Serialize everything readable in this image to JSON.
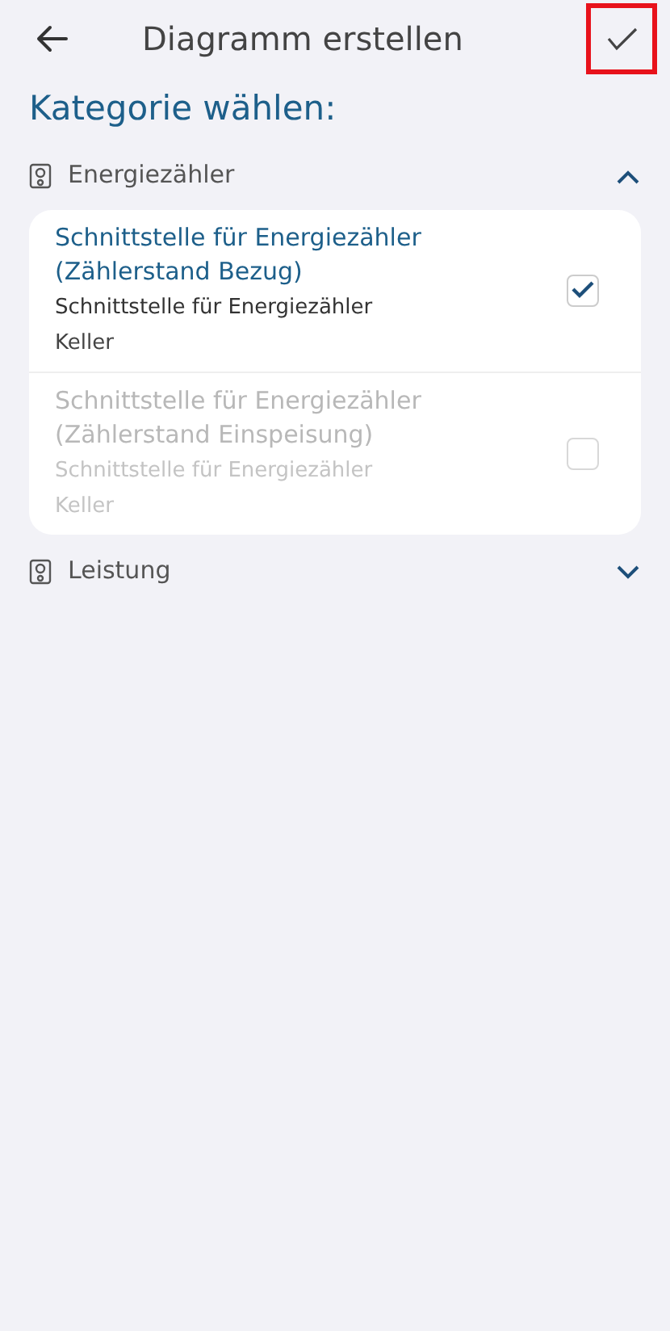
{
  "header": {
    "title": "Diagramm erstellen",
    "confirm_highlighted": true
  },
  "heading": "Kategorie wählen:",
  "groups": [
    {
      "label": "Energiezähler",
      "expanded": true,
      "items": [
        {
          "title": "Schnittstelle für Energiezähler (Zählerstand Bezug)",
          "subtitle": "Schnittstelle für Energiezähler",
          "location": "Keller",
          "checked": true,
          "disabled": false
        },
        {
          "title": "Schnittstelle für Energiezähler (Zählerstand Einspeisung)",
          "subtitle": "Schnittstelle für Energiezähler",
          "location": "Keller",
          "checked": false,
          "disabled": true
        }
      ]
    },
    {
      "label": "Leistung",
      "expanded": false
    }
  ]
}
